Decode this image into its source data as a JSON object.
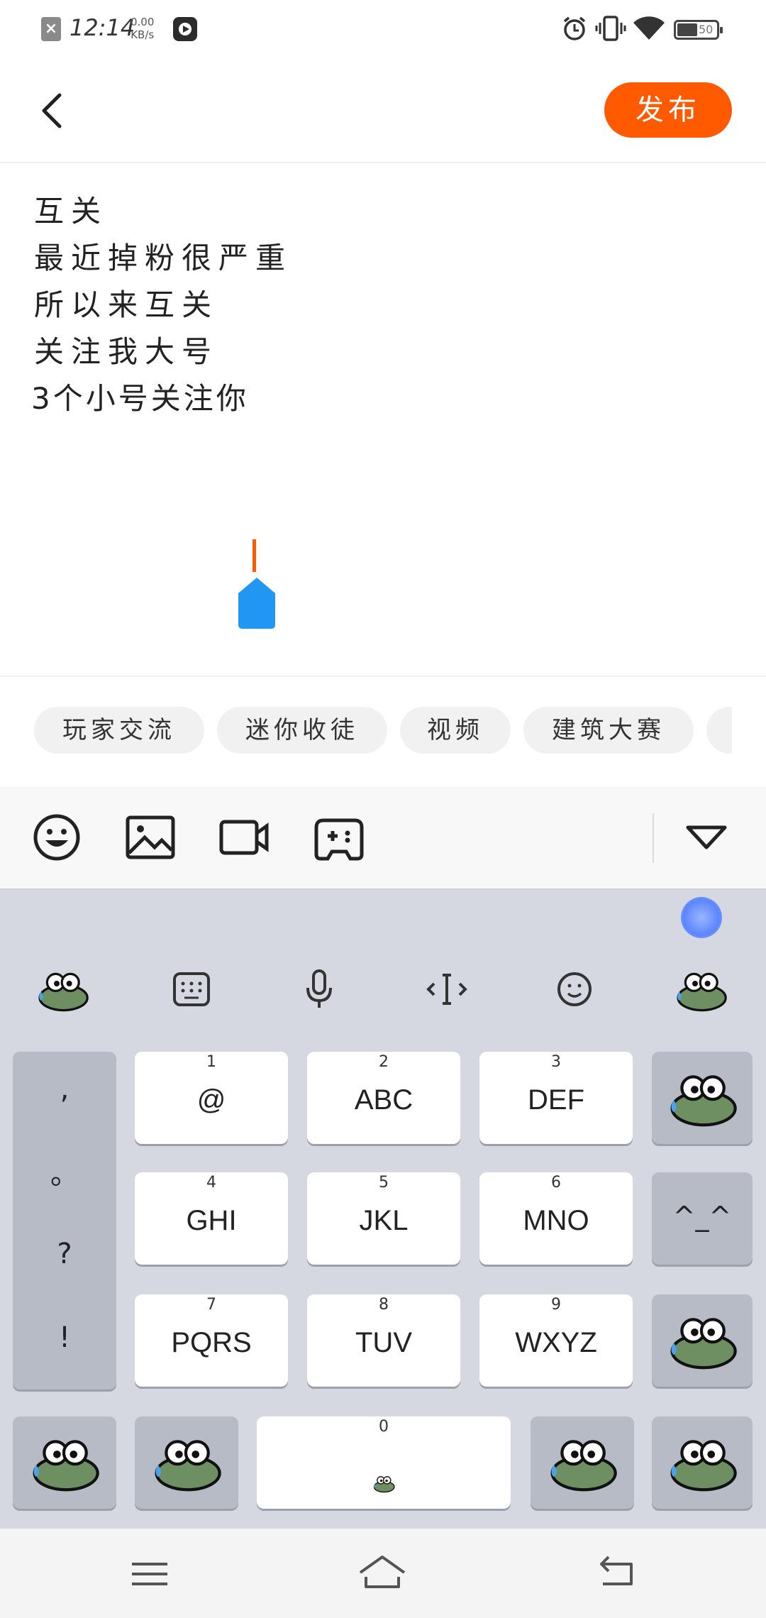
{
  "status_bar": {
    "time": "12:14",
    "net_speed": "0.00",
    "net_unit": "KB/s",
    "battery": "50"
  },
  "header": {
    "publish_label": "发布"
  },
  "post": {
    "lines": [
      "互关",
      "最近掉粉很严重",
      "所以来互关",
      "关注我大号",
      "3个小号关注你"
    ]
  },
  "topics": [
    "玩家交流",
    "迷你收徒",
    "视频",
    "建筑大赛"
  ],
  "keyboard": {
    "punctuation": [
      ",",
      "。",
      "?",
      "!"
    ],
    "keys": [
      {
        "num": "1",
        "letters": "@"
      },
      {
        "num": "2",
        "letters": "ABC"
      },
      {
        "num": "3",
        "letters": "DEF"
      },
      {
        "num": "4",
        "letters": "GHI"
      },
      {
        "num": "5",
        "letters": "JKL"
      },
      {
        "num": "6",
        "letters": "MNO"
      },
      {
        "num": "7",
        "letters": "PQRS"
      },
      {
        "num": "8",
        "letters": "TUV"
      },
      {
        "num": "9",
        "letters": "WXYZ"
      }
    ],
    "face_key": "^_^",
    "space_num": "0"
  },
  "colors": {
    "accent": "#ff5a00",
    "cursor_handle": "#2196f3",
    "keyboard_bg": "#d5d8e0"
  }
}
